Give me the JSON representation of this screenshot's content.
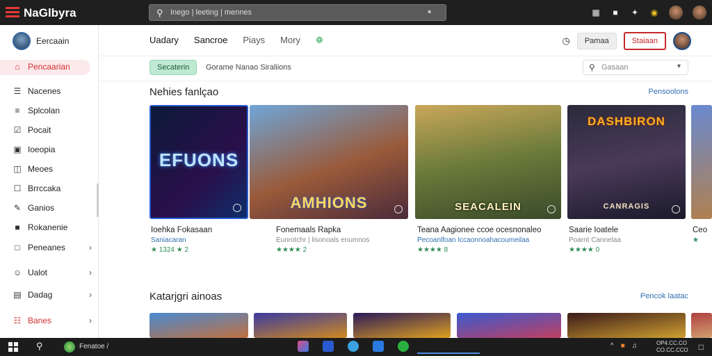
{
  "app": {
    "brand": "NaGlbyra"
  },
  "search": {
    "text": "Inego | leeting | mennes"
  },
  "sidebar": {
    "profile_name": "Eercaain",
    "items": [
      {
        "label": "Pencaarian",
        "icon": "home-icon"
      },
      {
        "label": "Nacenes",
        "icon": "book-icon"
      },
      {
        "label": "Splcolan",
        "icon": "layers-icon"
      },
      {
        "label": "Pocait",
        "icon": "check-icon"
      },
      {
        "label": "Ioeopia",
        "icon": "grid-icon"
      },
      {
        "label": "Meoes",
        "icon": "inbox-icon"
      },
      {
        "label": "Brrccaka",
        "icon": "checkbox-icon"
      },
      {
        "label": "Ganios",
        "icon": "edit-icon"
      },
      {
        "label": "Rokanenie",
        "icon": "store-icon"
      },
      {
        "label": "Peneanes",
        "icon": "square-icon"
      },
      {
        "label": "Ualot",
        "icon": "user-icon"
      },
      {
        "label": "Dadag",
        "icon": "list-icon"
      },
      {
        "label": "Banes",
        "icon": "calendar-icon"
      }
    ]
  },
  "header": {
    "tabs": [
      "Uadary",
      "Sancroe",
      "Piays",
      "Mory"
    ],
    "button_grey": "Pamaa",
    "button_red": "Staiaan"
  },
  "filters": {
    "chip": "Secaterin",
    "text": "Gorame Nanao Siraliions",
    "search_placeholder": "Gasaan"
  },
  "section1": {
    "title": "Nehies fanlçao",
    "link": "Pensoolons",
    "cards": [
      {
        "logo": "EFUONS",
        "title": "Ioehka Fokasaan",
        "sub": "Saniacaran",
        "rating": "★ 1324 ★ 2"
      },
      {
        "logo": "AMHIONS",
        "title": "Fonemaals Rapka",
        "sub": "Eunrotchr | lisonoals enumnos",
        "rating": "★★★★ 2"
      },
      {
        "logo": "SEACALEIN",
        "title": "Teana Aagionee ccoe ocesnonaleo",
        "sub": "Pecoanlfoan Iccaonnoahacoumeilaa",
        "rating": "★★★★ 8"
      },
      {
        "logo": "DASHBIRON",
        "logo2": "CANRAGIS",
        "title": "Saarie Ioatele",
        "sub": "Poarnt Cannelaa",
        "rating": "★★★★ 0"
      },
      {
        "title": "Ceo",
        "sub": "",
        "rating": "★"
      }
    ]
  },
  "section2": {
    "title": "Katarjgri ainoas",
    "link": "Pencok laatac"
  },
  "taskbar": {
    "app_text": "Fenatoe /",
    "time_line1": "OP4.CC.CO",
    "time_line2": "CO.CC.CCO"
  },
  "colors": {
    "accent_red": "#c62828",
    "accent_green": "#3dae6e",
    "link_blue": "#2f6fb2"
  }
}
